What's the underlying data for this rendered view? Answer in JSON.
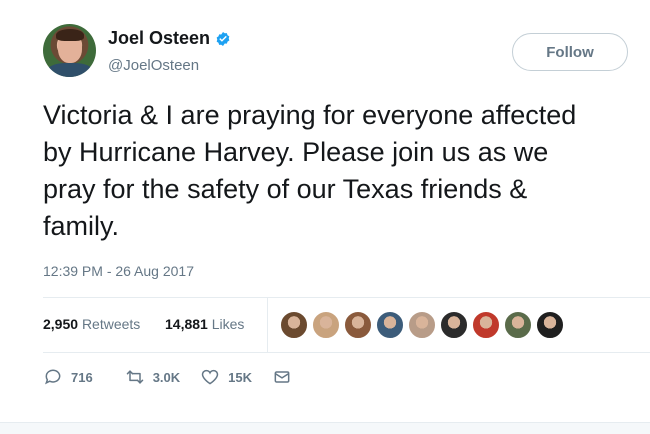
{
  "user": {
    "display_name": "Joel Osteen",
    "handle": "@JoelOsteen",
    "verified": true
  },
  "follow_button": {
    "label": "Follow"
  },
  "tweet": {
    "lines": [
      "Victoria & I are praying for everyone affected",
      "by Hurricane Harvey. Please join us as we",
      "pray for the safety of our Texas friends &",
      "family."
    ],
    "timestamp": "12:39 PM - 26 Aug 2017"
  },
  "stats": {
    "retweets_count": "2,950",
    "retweets_label": "Retweets",
    "likes_count": "14,881",
    "likes_label": "Likes"
  },
  "liker_avatars": [
    {
      "color": "#6b4a2f"
    },
    {
      "color": "#c9a37e"
    },
    {
      "color": "#8a5a3c"
    },
    {
      "color": "#3c5c7a"
    },
    {
      "color": "#b89c88"
    },
    {
      "color": "#2b2b2b"
    },
    {
      "color": "#c0392b"
    },
    {
      "color": "#5a6b4a"
    },
    {
      "color": "#1f1f1f"
    }
  ],
  "actions": {
    "replies": "716",
    "retweets": "3.0K",
    "likes": "15K"
  },
  "colors": {
    "accent": "#1da1f2",
    "secondary_text": "#657786",
    "primary_text": "#14171a"
  }
}
